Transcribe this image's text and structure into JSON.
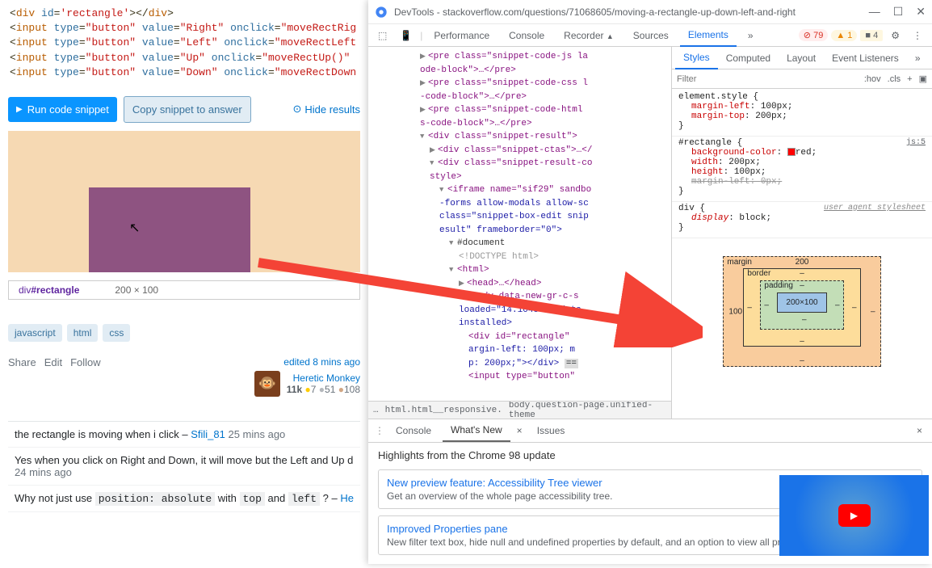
{
  "code": {
    "line1": "<div id='rectangle'></div>",
    "line2": "<input type=\"button\" value=\"Right\" onclick=\"moveRectRig",
    "line3": "<input type=\"button\" value=\"Left\" onclick=\"moveRectLeft",
    "line4": "<input type=\"button\" value=\"Up\" onclick=\"moveRectUp()\"",
    "line5": "<input type=\"button\" value=\"Down\" onclick=\"moveRectDown"
  },
  "snippet": {
    "run": "Run code snippet",
    "copy": "Copy snippet to answer",
    "hide": "Hide results"
  },
  "inspector": {
    "crumb": "div#rectangle",
    "dims": "200 × 100"
  },
  "tags": [
    "javascript",
    "html",
    "css"
  ],
  "actions": {
    "share": "Share",
    "edit": "Edit",
    "follow": "Follow"
  },
  "edited": "edited 8 mins ago",
  "user": {
    "name": "Heretic Monkey",
    "rep": "11k",
    "gold": "7",
    "silver": "51",
    "bronze": "108"
  },
  "comments": [
    {
      "text": "the rectangle is moving when i click – ",
      "author": "Sfili_81",
      "time": " 25 mins ago"
    },
    {
      "text": "Yes when you click on Right and Down, it will move but the Left and Up d",
      "time": "24 mins ago"
    },
    {
      "text": "Why not just use ",
      "code": "position: absolute",
      "text2": " with ",
      "code2": "top",
      "text3": " and ",
      "code3": "left",
      "text4": " ? – ",
      "author": "He"
    }
  ],
  "devtools": {
    "title": "DevTools - stackoverflow.com/questions/71068605/moving-a-rectangle-up-down-left-and-right",
    "tabs": [
      "Performance",
      "Console",
      "Recorder",
      "Sources",
      "Elements"
    ],
    "more": "»",
    "errors": "79",
    "warnings": "1",
    "messages": "4",
    "stylesTabs": [
      "Styles",
      "Computed",
      "Layout",
      "Event Listeners"
    ],
    "filter": "Filter",
    "filterOpts": [
      ":hov",
      ".cls",
      "+"
    ],
    "rules": {
      "elementStyle": {
        "selector": "element.style",
        "props": [
          {
            "name": "margin-left",
            "value": "100px"
          },
          {
            "name": "margin-top",
            "value": "200px"
          }
        ]
      },
      "rectangle": {
        "selector": "#rectangle",
        "source": "js:5",
        "props": [
          {
            "name": "background-color",
            "value": "red",
            "color": "#ff0000"
          },
          {
            "name": "width",
            "value": "200px"
          },
          {
            "name": "height",
            "value": "100px"
          },
          {
            "name": "margin-left",
            "value": "0px",
            "struck": true
          }
        ]
      },
      "ua": {
        "selector": "div",
        "source": "user agent stylesheet",
        "props": [
          {
            "name": "display",
            "value": "block"
          }
        ]
      }
    },
    "boxModel": {
      "marginLabel": "margin",
      "borderLabel": "border",
      "paddingLabel": "padding",
      "margin": {
        "top": "200",
        "right": "–",
        "bottom": "–",
        "left": "100"
      },
      "border": {
        "top": "–",
        "right": "–",
        "bottom": "–",
        "left": "–"
      },
      "padding": {
        "top": "–",
        "right": "–",
        "bottom": "–",
        "left": "–"
      },
      "content": "200×100"
    },
    "breadcrumbs": [
      "…",
      "html.html__responsive.",
      "body.question-page.unified-theme"
    ],
    "consoleTabs": [
      "Console",
      "What's New",
      "Issues"
    ],
    "whatsNew": {
      "heading": "Highlights from the Chrome 98 update",
      "features": [
        {
          "title": "New preview feature: Accessibility Tree viewer",
          "desc": "Get an overview of the whole page accessibility tree."
        },
        {
          "title": "Improved Properties pane",
          "desc": "New filter text box, hide null and undefined properties by default, and an option to view all properties."
        }
      ]
    },
    "dom": {
      "pre1": "<pre class=\"snippet-code-js la",
      "pre1b": "ode-block\">…</pre>",
      "pre2": "<pre class=\"snippet-code-css l",
      "pre2b": "-code-block\">…</pre>",
      "pre3": "<pre class=\"snippet-code-html ",
      "pre3b": "s-code-block\">…</pre>",
      "div1": "<div class=\"snippet-result\">",
      "div2": "<div class=\"snippet-ctas\">…</",
      "div3": "<div class=\"snippet-result-co",
      "div3b": "style>",
      "iframe": "<iframe name=\"sif29\" sandbo",
      "iframe2": "-forms allow-modals allow-sc",
      "iframe3": "class=\"snippet-box-edit snip",
      "iframe4": "esult\" frameborder=\"0\">",
      "doc": "#document",
      "doctype": "<!DOCTYPE html>",
      "html": "<html>",
      "head": "<head>…</head>",
      "body": "<body data-new-gr-c-s",
      "body2": "loaded=\"14.1048.0\" data",
      "body3": "installed>",
      "rect": "<div id=\"rectangle\"",
      "rect2": "argin-left: 100px; m",
      "rect3": "p: 200px;\"></div>",
      "input": "<input type=\"button\""
    }
  }
}
